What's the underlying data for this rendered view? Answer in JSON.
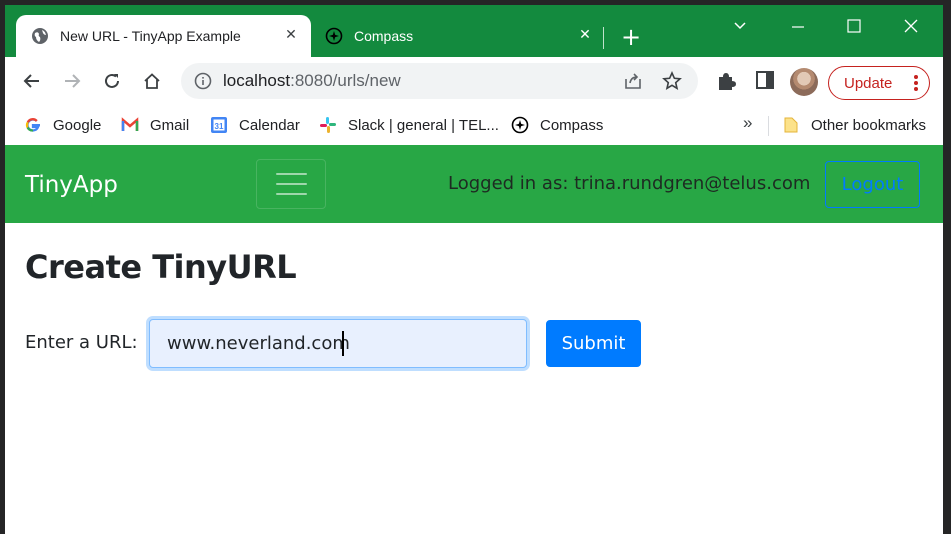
{
  "browser": {
    "tabs": [
      {
        "title": "New URL - TinyApp Example",
        "active": true
      },
      {
        "title": "Compass",
        "active": false
      }
    ],
    "address": {
      "host": "localhost",
      "path": ":8080/urls/new"
    },
    "update_label": "Update",
    "bookmarks": [
      {
        "label": "Google"
      },
      {
        "label": "Gmail"
      },
      {
        "label": "Calendar"
      },
      {
        "label": "Slack | general | TEL..."
      },
      {
        "label": "Compass"
      }
    ],
    "bookmarks_more": "»",
    "other_bookmarks": "Other bookmarks"
  },
  "app": {
    "brand": "TinyApp",
    "logged_in_text": "Logged in as: trina.rundgren@telus.com",
    "logout_label": "Logout",
    "heading": "Create TinyURL",
    "form": {
      "label": "Enter a URL:",
      "value": "www.neverland.com",
      "submit_label": "Submit"
    }
  },
  "colors": {
    "chrome_frame": "#138a3e",
    "navbar": "#28a745",
    "primary": "#007bff"
  }
}
